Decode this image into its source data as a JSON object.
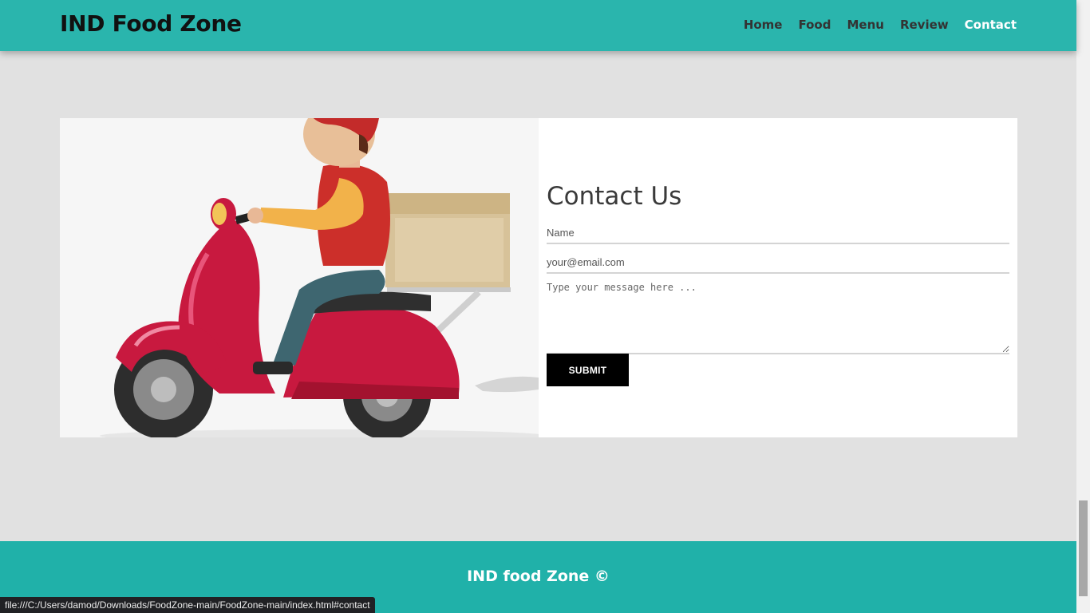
{
  "header": {
    "brand": "IND Food Zone",
    "nav": [
      {
        "label": "Home",
        "active": false
      },
      {
        "label": "Food",
        "active": false
      },
      {
        "label": "Menu",
        "active": false
      },
      {
        "label": "Review",
        "active": false
      },
      {
        "label": "Contact",
        "active": true
      }
    ]
  },
  "contact": {
    "title": "Contact Us",
    "name_placeholder": "Name",
    "email_placeholder": "your@email.com",
    "message_placeholder": "Type your message here ...",
    "submit_label": "SUBMIT",
    "illustration_icon": "delivery-scooter-illustration"
  },
  "footer": {
    "text": "IND food Zone ©"
  },
  "status_bar": {
    "url": "file:///C:/Users/damod/Downloads/FoodZone-main/FoodZone-main/index.html#contact"
  },
  "colors": {
    "header_bg": "#2ab5ad",
    "footer_bg": "#20b1a9",
    "page_bg": "#e1e1e1",
    "submit_bg": "#000000",
    "scooter_red": "#c8193f"
  }
}
